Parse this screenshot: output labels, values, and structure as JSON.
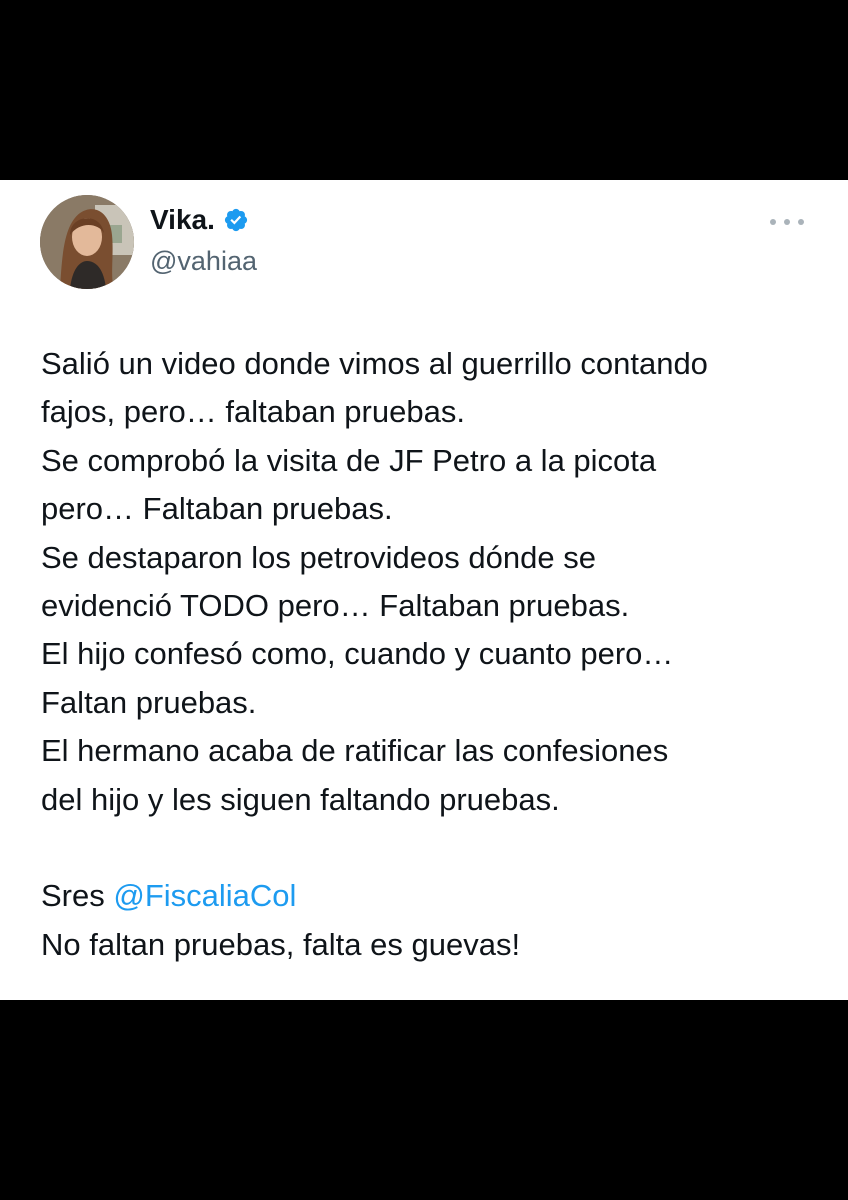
{
  "colors": {
    "background": "#000000",
    "card": "#ffffff",
    "text": "#0f1419",
    "secondary": "#536471",
    "link": "#1d9bf0",
    "verified_badge": "#1d9bf0"
  },
  "author": {
    "display_name": "Vika.",
    "handle": "@vahiaa",
    "verified": true,
    "verified_icon": "verified-badge-icon",
    "avatar_icon": "profile-photo"
  },
  "menu": {
    "icon": "more-options-icon"
  },
  "tweet": {
    "lines": [
      "Salió un video donde vimos al guerrillo contando",
      "fajos, pero… faltaban pruebas.",
      "Se comprobó la visita de JF Petro a la picota",
      "pero… Faltaban pruebas.",
      "Se destaparon los petrovideos dónde se",
      "evidenció TODO pero… Faltaban pruebas.",
      "El hijo confesó como, cuando y cuanto pero…",
      "Faltan pruebas.",
      "El hermano acaba de ratificar las confesiones",
      "del hijo y les siguen faltando pruebas."
    ],
    "closing_prefix": "Sres ",
    "mention": "@FiscaliaCol",
    "closing_line": "No faltan pruebas, falta es guevas!"
  }
}
